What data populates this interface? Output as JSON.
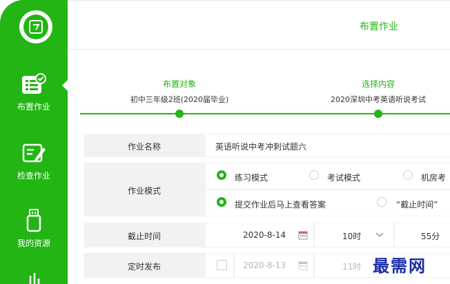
{
  "sidebar": {
    "items": [
      {
        "label": "布置作业",
        "icon": "assign-homework-icon",
        "active": true
      },
      {
        "label": "检查作业",
        "icon": "check-homework-icon"
      },
      {
        "label": "我的资源",
        "icon": "usb-drive-icon"
      }
    ],
    "logo_icon": "app-logo-icon",
    "accent": "#22b514"
  },
  "header": {
    "title": "布置作业"
  },
  "steps": [
    {
      "title": "布置对象",
      "subtitle": "初中三年级2班(2020届毕业)"
    },
    {
      "title": "选择内容",
      "subtitle": "2020深圳中考英语听说考试"
    }
  ],
  "form": {
    "name_label": "作业名称",
    "name_value": "英语听说中考冲刺试题六",
    "mode_label": "作业模式",
    "mode_options": [
      "练习模式",
      "考试模式",
      "机房考"
    ],
    "answer_options": [
      "提交作业后马上查看答案",
      "“截止时间”"
    ],
    "deadline_label": "截止时间",
    "deadline_date": "2020-8-14",
    "deadline_hour": "10时",
    "deadline_minute": "55分",
    "schedule_label": "定时发布",
    "schedule_date": "2020-8-13",
    "schedule_hour": "11时"
  },
  "watermark": "最需网"
}
